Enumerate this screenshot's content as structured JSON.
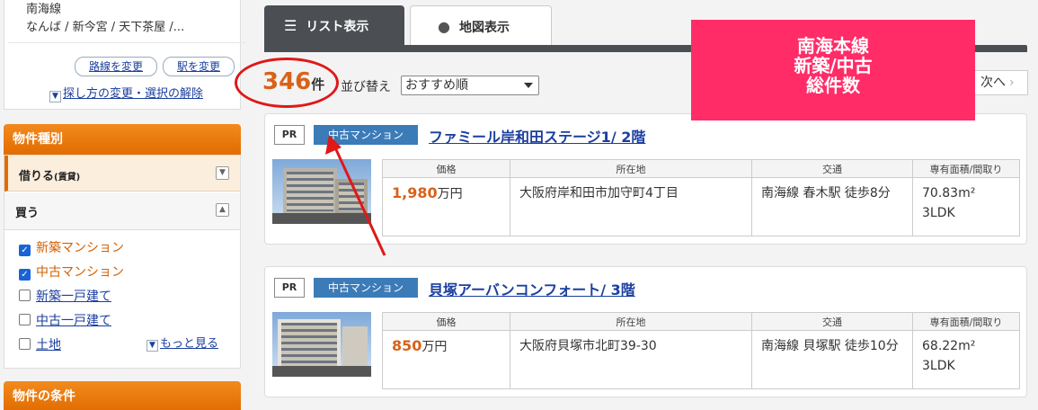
{
  "sidebar": {
    "area_line1": "南海線",
    "area_line2": "なんば / 新今宮 / 天下茶屋 /...",
    "change_route": "路線を変更",
    "change_station": "駅を変更",
    "help_link": "探し方の変更・選択の解除",
    "panel_type_title": "物件種別",
    "rent_label": "借りる",
    "rent_sub": "(賃貸)",
    "buy_label": "買う",
    "items": [
      {
        "label": "新築マンション",
        "checked": true
      },
      {
        "label": "中古マンション",
        "checked": true
      },
      {
        "label": "新築一戸建て",
        "checked": false
      },
      {
        "label": "中古一戸建て",
        "checked": false
      },
      {
        "label": "土地",
        "checked": false
      }
    ],
    "more_link": "もっと見る",
    "panel_conditions_title": "物件の条件"
  },
  "tabs": {
    "list": "リスト表示",
    "map": "地図表示"
  },
  "results": {
    "count": "346",
    "count_unit": "件",
    "sort_label": "並び替え",
    "sort_value": "おすすめ順",
    "next": "次へ"
  },
  "overlay": {
    "line1": "南海本線",
    "line2": "新築/中古",
    "line3": "総件数"
  },
  "table_headers": [
    "価格",
    "所在地",
    "交通",
    "専有面積/間取り"
  ],
  "listings": [
    {
      "pr": "PR",
      "kind": "中古マンション",
      "title": "ファミール岸和田ステージ1/ 2階",
      "price": "1,980",
      "price_unit": "万円",
      "address": "大阪府岸和田市加守町4丁目",
      "access": "南海線 春木駅 徒歩8分",
      "area": "70.83m²",
      "layout": "3LDK"
    },
    {
      "pr": "PR",
      "kind": "中古マンション",
      "title": "貝塚アーバンコンフォート/ 3階",
      "price": "850",
      "price_unit": "万円",
      "address": "大阪府貝塚市北町39-30",
      "access": "南海線 貝塚駅 徒歩10分",
      "area": "68.22m²",
      "layout": "3LDK"
    }
  ],
  "colors": {
    "accent_orange": "#e26c00",
    "price_orange": "#d8621a",
    "tab_dark": "#4b4f54",
    "overlay_pink": "#ff2c68",
    "annotation_red": "#e01818"
  }
}
